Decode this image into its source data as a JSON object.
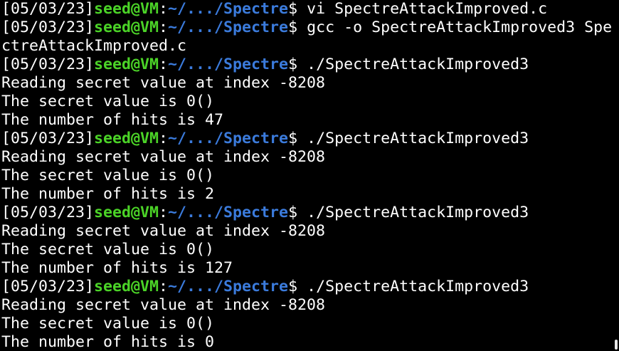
{
  "terminal": {
    "lines": [
      {
        "type": "prompt",
        "date": "[05/03/23]",
        "user": "seed@VM",
        "colon": ":",
        "path": "~/.../Spectre",
        "symbol": "$ ",
        "command": "vi SpectreAttackImproved.c"
      },
      {
        "type": "prompt",
        "date": "[05/03/23]",
        "user": "seed@VM",
        "colon": ":",
        "path": "~/.../Spectre",
        "symbol": "$ ",
        "command": "gcc -o SpectreAttackImproved3 Spe"
      },
      {
        "type": "output",
        "text": "ctreAttackImproved.c"
      },
      {
        "type": "prompt",
        "date": "[05/03/23]",
        "user": "seed@VM",
        "colon": ":",
        "path": "~/.../Spectre",
        "symbol": "$ ",
        "command": "./SpectreAttackImproved3"
      },
      {
        "type": "output",
        "text": "Reading secret value at index -8208"
      },
      {
        "type": "output",
        "text": "The secret value is 0()"
      },
      {
        "type": "output",
        "text": "The number of hits is 47"
      },
      {
        "type": "prompt",
        "date": "[05/03/23]",
        "user": "seed@VM",
        "colon": ":",
        "path": "~/.../Spectre",
        "symbol": "$ ",
        "command": "./SpectreAttackImproved3"
      },
      {
        "type": "output",
        "text": "Reading secret value at index -8208"
      },
      {
        "type": "output",
        "text": "The secret value is 0()"
      },
      {
        "type": "output",
        "text": "The number of hits is 2"
      },
      {
        "type": "prompt",
        "date": "[05/03/23]",
        "user": "seed@VM",
        "colon": ":",
        "path": "~/.../Spectre",
        "symbol": "$ ",
        "command": "./SpectreAttackImproved3"
      },
      {
        "type": "output",
        "text": "Reading secret value at index -8208"
      },
      {
        "type": "output",
        "text": "The secret value is 0()"
      },
      {
        "type": "output",
        "text": "The number of hits is 127"
      },
      {
        "type": "prompt",
        "date": "[05/03/23]",
        "user": "seed@VM",
        "colon": ":",
        "path": "~/.../Spectre",
        "symbol": "$ ",
        "command": "./SpectreAttackImproved3"
      },
      {
        "type": "output",
        "text": "Reading secret value at index -8208"
      },
      {
        "type": "output",
        "text": "The secret value is 0()"
      },
      {
        "type": "output",
        "text": "The number of hits is 0"
      }
    ]
  },
  "colors": {
    "background": "#000000",
    "text": "#ffffff",
    "user": "#4bd327",
    "path": "#3b7bdc"
  }
}
